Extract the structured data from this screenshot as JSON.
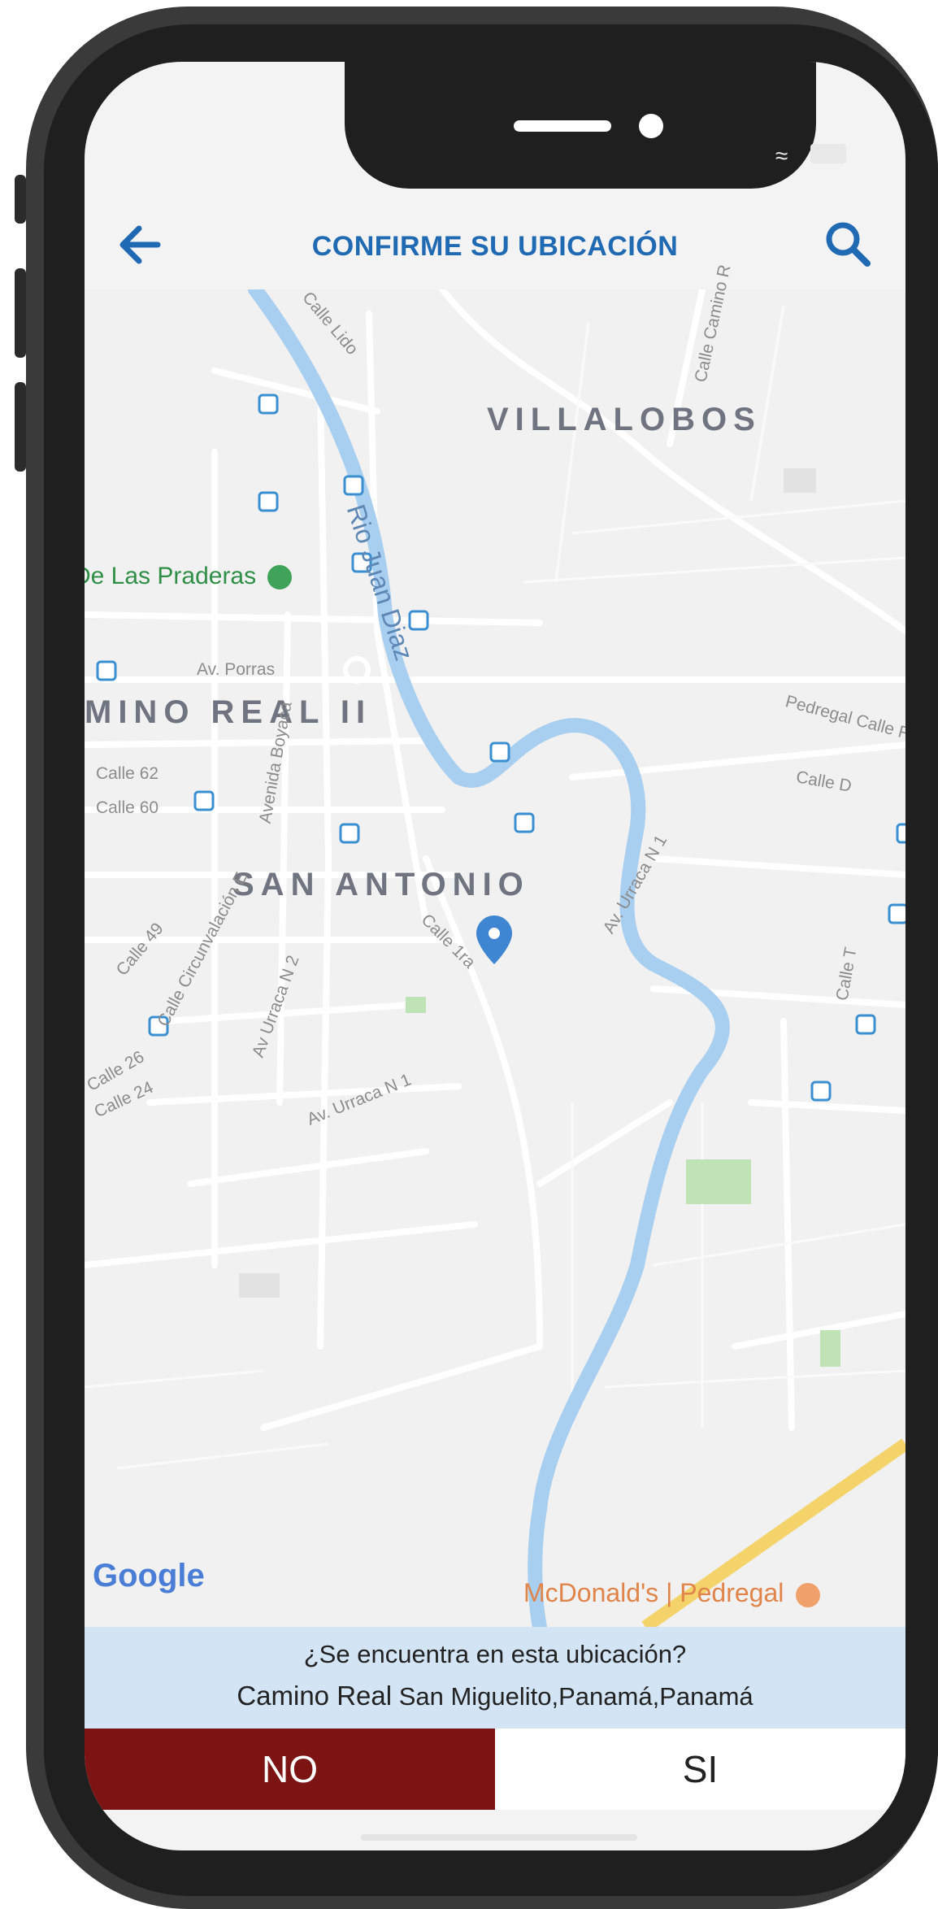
{
  "header": {
    "title": "CONFIRME SU UBICACIÓN",
    "back_icon": "arrow-left-icon",
    "search_icon": "search-icon",
    "accent_color": "#1f6ab3"
  },
  "status_bar": {
    "icons": [
      "wifi-icon",
      "battery-icon"
    ]
  },
  "map": {
    "districts": [
      "VILLALOBOS",
      "MINO REAL II",
      "SAN ANTONIO"
    ],
    "river": "Rio Juan Diaz",
    "streets": [
      "Calle Lido",
      "Calle Camino R",
      "Av. Porras",
      "Calle 62",
      "Calle 60",
      "Avenida Boyaca",
      "Calle 49",
      "Calle Circunvalación E",
      "Av Urraca N 2",
      "Calle 1ra",
      "Av. Urraca N 1",
      "Av. Urraca N 1",
      "Pedregal Calle F",
      "Calle D",
      "Calle T",
      "Calle 26",
      "Calle 24"
    ],
    "pois": {
      "park": "De Las Praderas",
      "restaurant": "McDonald's | Pedregal"
    },
    "attribution": "Google",
    "pin_icon": "location-pin-icon",
    "bus_icon": "bus-stop-icon"
  },
  "confirm": {
    "question": "¿Se encuentra en esta ubicación?",
    "place": "Camino Real",
    "region": "San Miguelito,Panamá,Panamá",
    "no_label": "NO",
    "yes_label": "SI",
    "no_color": "#7d1414"
  }
}
